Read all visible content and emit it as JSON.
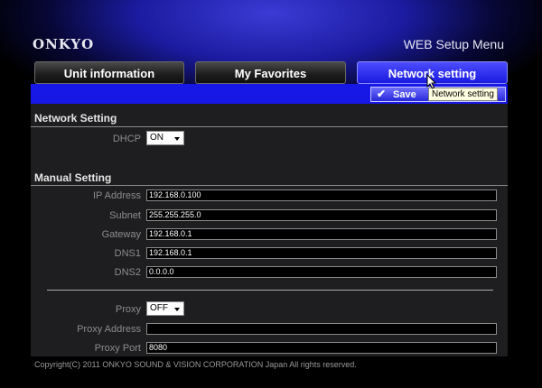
{
  "header": {
    "brand": "ONKYO",
    "menu_title": "WEB Setup Menu"
  },
  "tabs": [
    {
      "label": "Unit information",
      "active": false
    },
    {
      "label": "My Favorites",
      "active": false
    },
    {
      "label": "Network setting",
      "active": true
    }
  ],
  "toolbar": {
    "save_label": "Save",
    "tooltip": "Network setting"
  },
  "network_setting": {
    "title": "Network Setting",
    "dhcp_label": "DHCP",
    "dhcp_value": "ON"
  },
  "manual_setting": {
    "title": "Manual Setting",
    "fields": [
      {
        "label": "IP Address",
        "value": "192.168.0.100"
      },
      {
        "label": "Subnet",
        "value": "255.255.255.0"
      },
      {
        "label": "Gateway",
        "value": "192.168.0.1"
      },
      {
        "label": "DNS1",
        "value": "192.168.0.1"
      },
      {
        "label": "DNS2",
        "value": "0.0.0.0"
      }
    ],
    "proxy_label": "Proxy",
    "proxy_value": "OFF",
    "proxy_address_label": "Proxy Address",
    "proxy_address_value": "",
    "proxy_port_label": "Proxy Port",
    "proxy_port_value": "8080"
  },
  "footer": {
    "copyright": "Copyright(C) 2011 ONKYO SOUND & VISION CORPORATION Japan All rights reserved."
  },
  "colors": {
    "accent_blue": "#1717e6",
    "active_tab": "#2a2aee",
    "panel_bg": "#1e1e20"
  }
}
